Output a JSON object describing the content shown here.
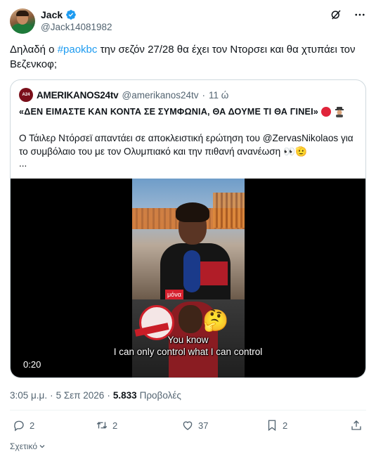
{
  "author": {
    "display_name": "Jack",
    "handle": "@Jack14081982",
    "verified_icon": "verified-badge-icon"
  },
  "header_icons": [
    "grok-icon",
    "more-icon"
  ],
  "tweet": {
    "text_before": "Δηλαδή ο ",
    "hashtag": "#paokbc",
    "text_after": " την σεζόν 27/28 θα έχει τον Ντορσει και θα χτυπάει τον Βεζενκοφ;"
  },
  "quote": {
    "avatar_text": "A24",
    "name": "AMERIKANOS24tv",
    "handle": "@amerikanos24tv",
    "separator": "·",
    "time": "11 ώ",
    "title": "«ΔΕΝ ΕΙΜΑΣΤΕ ΚΑΝ ΚΟΝΤΑ ΣΕ ΣΥΜΦΩΝΙΑ, ΘΑ ΔΟΥΜΕ ΤΙ ΘΑ ΓΙΝΕΙ»",
    "title_emojis": [
      "red-circle-icon",
      "detective-icon"
    ],
    "body": "Ο Τάιλερ Ντόρσεϊ απαντάει σε αποκλειστική ερώτηση του @ZervasNikolaos για το συμβόλαιο του με τον Ολυμπιακό και την πιθανή ανανέωση 👀🫡",
    "ellipsis": "..."
  },
  "video": {
    "caption_tag": "μόνα",
    "subtitle_line1": "You know",
    "subtitle_line2": "I can only control what I can control",
    "timestamp": "0:20",
    "emoji": "🤔"
  },
  "meta": {
    "time": "3:05 μ.μ.",
    "dot": "·",
    "date": "5 Σεπ 2026",
    "views_count": "5.833",
    "views_label": "Προβολές"
  },
  "actions": {
    "replies": "2",
    "reposts": "2",
    "likes": "37",
    "bookmarks": "2"
  },
  "related_label": "Σχετικό"
}
